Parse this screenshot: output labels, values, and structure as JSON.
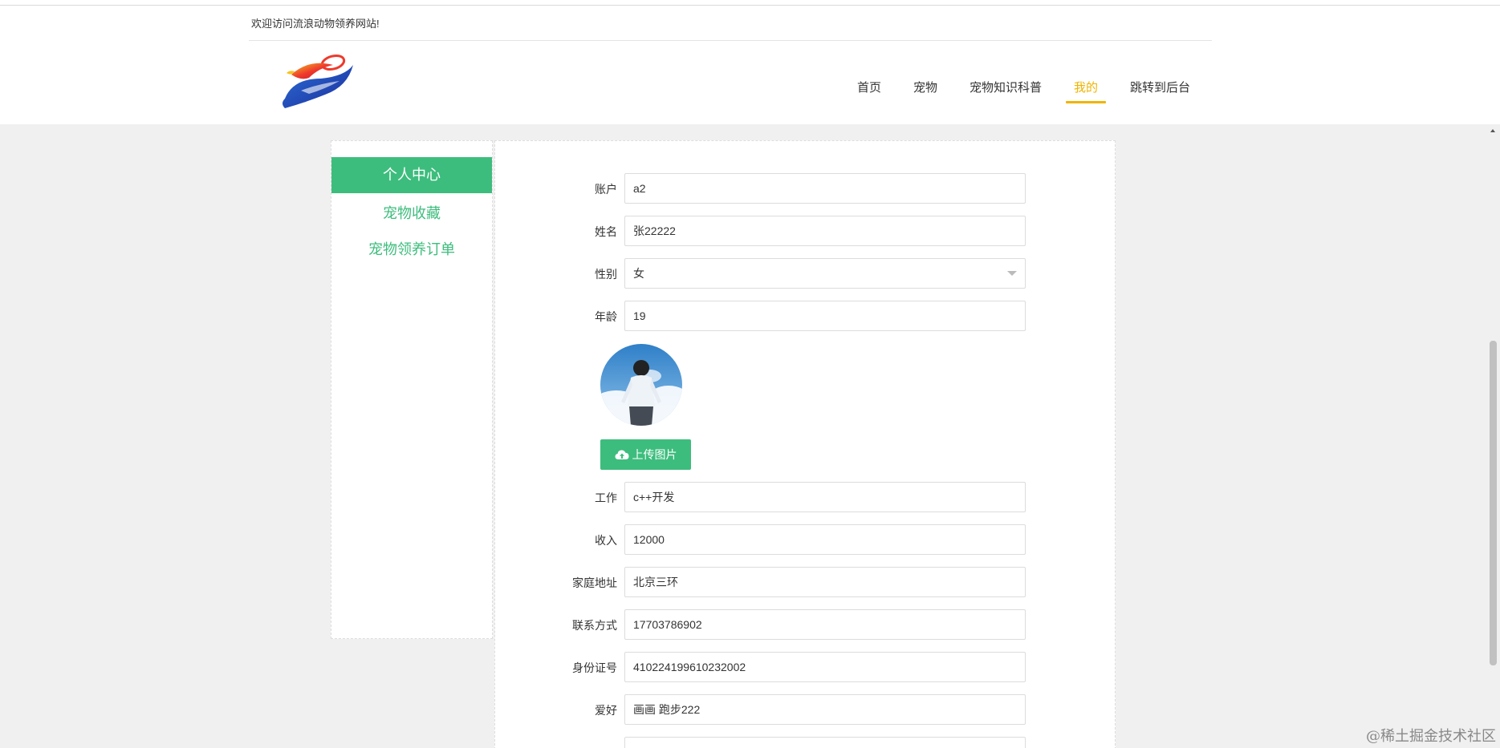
{
  "header": {
    "welcome": "欢迎访问流浪动物领养网站!",
    "nav": [
      {
        "label": "首页"
      },
      {
        "label": "宠物"
      },
      {
        "label": "宠物知识科普"
      },
      {
        "label": "我的",
        "active": true
      },
      {
        "label": "跳转到后台"
      }
    ]
  },
  "sidebar": {
    "items": [
      {
        "label": "个人中心",
        "active": true
      },
      {
        "label": "宠物收藏"
      },
      {
        "label": "宠物领养订单"
      }
    ]
  },
  "form": {
    "account": {
      "label": "账户",
      "value": "a2"
    },
    "name": {
      "label": "姓名",
      "value": "张22222"
    },
    "gender": {
      "label": "性别",
      "value": "女"
    },
    "age": {
      "label": "年龄",
      "value": "19"
    },
    "upload_label": "上传图片",
    "job": {
      "label": "工作",
      "value": "c++开发"
    },
    "income": {
      "label": "收入",
      "value": "12000"
    },
    "address": {
      "label": "家庭地址",
      "value": "北京三环"
    },
    "contact": {
      "label": "联系方式",
      "value": "17703786902"
    },
    "id_card": {
      "label": "身份证号",
      "value": "410224199610232002"
    },
    "hobby": {
      "label": "爱好",
      "value": "画画 跑步222"
    }
  },
  "watermark": "@稀土掘金技术社区",
  "colors": {
    "accent": "#3dbd7d",
    "nav_active": "#f0b400"
  }
}
